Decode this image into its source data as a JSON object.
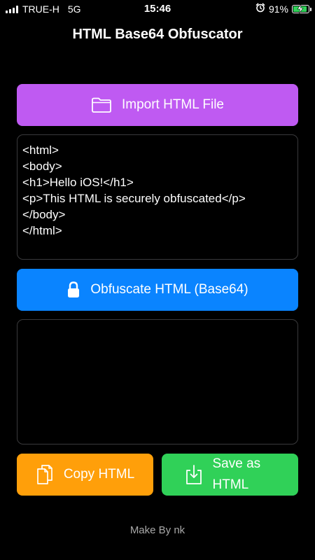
{
  "status_bar": {
    "carrier": "TRUE-H",
    "network": "5G",
    "time": "15:46",
    "battery_percent_text": "91%",
    "battery_level": 0.91,
    "battery_color": "#30d158"
  },
  "header": {
    "title": "HTML Base64 Obfuscator"
  },
  "import_button": {
    "label": "Import HTML File",
    "icon": "folder-icon",
    "color": "#bf5af2"
  },
  "input_editor": {
    "value": "<html>\n<body>\n<h1>Hello iOS!</h1>\n<p>This HTML is securely obfuscated</p>\n</body>\n</html>"
  },
  "obfuscate_button": {
    "label": "Obfuscate HTML (Base64)",
    "icon": "lock-icon",
    "color": "#0a84ff"
  },
  "output_editor": {
    "value": ""
  },
  "copy_button": {
    "label": "Copy HTML",
    "icon": "copy-icon",
    "color": "#ff9f0a"
  },
  "save_button": {
    "label": "Save as HTML",
    "icon": "download-icon",
    "color": "#30d158"
  },
  "footer": {
    "text": "Make By nk"
  }
}
